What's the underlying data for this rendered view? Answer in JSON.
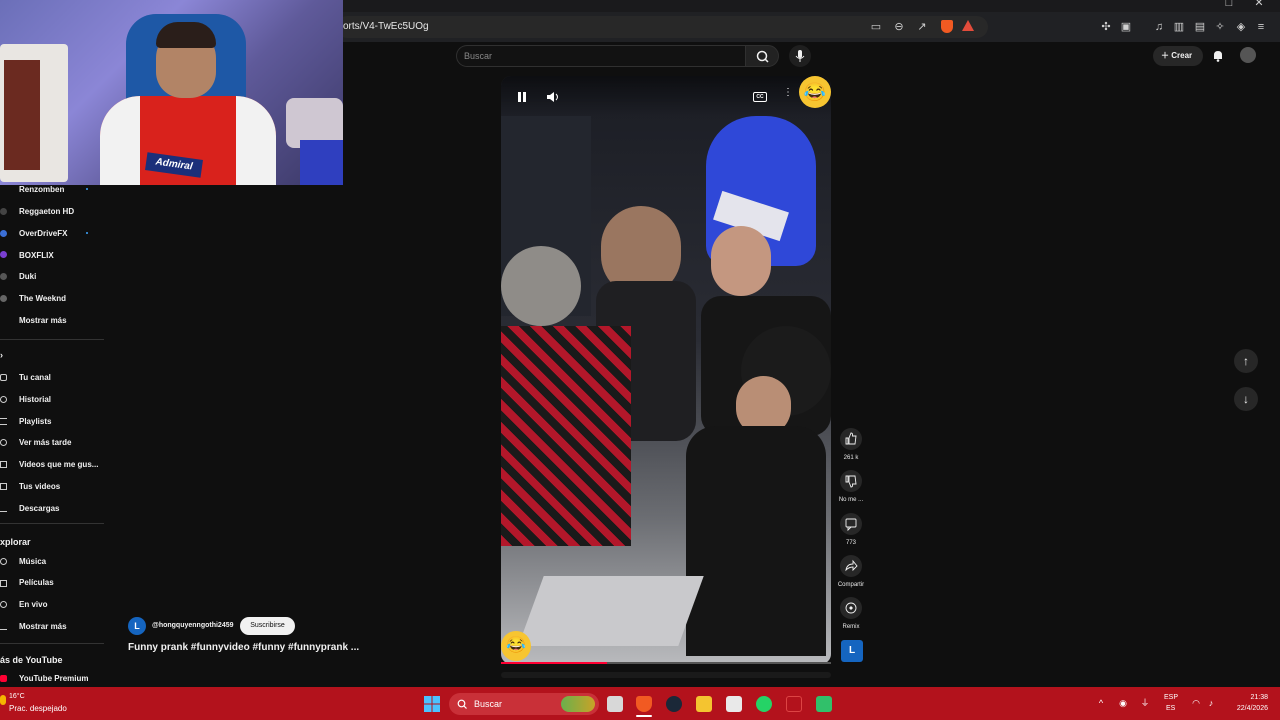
{
  "browser": {
    "url": "orts/V4-TwEc5UOg"
  },
  "youtube": {
    "search_placeholder": "Buscar",
    "create_label": "Crear"
  },
  "sidebar": {
    "subscriptions": [
      {
        "label": "Renzomben",
        "new": true
      },
      {
        "label": "Reggaeton HD",
        "new": false
      },
      {
        "label": "OverDriveFX",
        "new": true
      },
      {
        "label": "BOXFLIX",
        "new": false
      },
      {
        "label": "Duki",
        "new": false
      },
      {
        "label": "The Weeknd",
        "new": false
      }
    ],
    "show_more_1": "Mostrar más",
    "you_section": [
      {
        "label": "Tu canal"
      },
      {
        "label": "Historial"
      },
      {
        "label": "Playlists"
      },
      {
        "label": "Ver más tarde"
      },
      {
        "label": "Videos que me gus..."
      },
      {
        "label": "Tus videos"
      },
      {
        "label": "Descargas"
      }
    ],
    "explore_heading": "xplorar",
    "explore": [
      {
        "label": "Música"
      },
      {
        "label": "Películas"
      },
      {
        "label": "En vivo"
      }
    ],
    "show_more_2": "Mostrar más",
    "more_heading": "ás de YouTube",
    "premium": "YouTube Premium"
  },
  "short": {
    "channel_initial": "L",
    "channel_name": "@hongquyenngothi2459",
    "subscribe_label": "Suscribirse",
    "title": "Funny prank #funnyvideo #funny #funnyprank ...",
    "progress": 0.32,
    "likes": "261 k",
    "dislike_label": "No me ...",
    "comments": "773",
    "share_label": "Compartir",
    "remix_label": "Remix"
  },
  "webcam": {
    "shirt_logo": "Admiral"
  },
  "taskbar": {
    "weather_temp": "16°C",
    "weather_desc": "Prac. despejado",
    "search_label": "Buscar",
    "lang_top": "ESP",
    "lang_bottom": "ES",
    "time": "21:38",
    "date": "22/4/2026"
  },
  "colors": {
    "taskbar": "#b3121c",
    "accent_red": "#ff0033",
    "channel_blue": "#1565c0"
  }
}
